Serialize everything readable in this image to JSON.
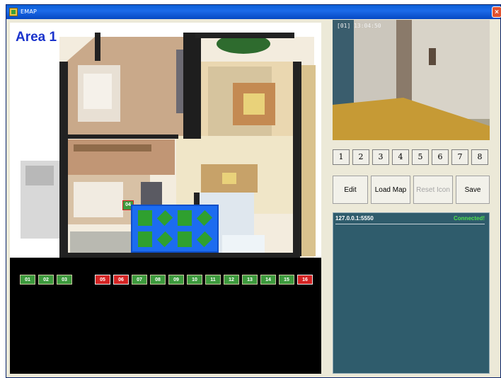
{
  "window": {
    "title": "EMAP",
    "close_glyph": "×"
  },
  "map": {
    "area_title": "Area 1",
    "placed_camera_label": "04",
    "icon_palette": [
      "camera-right-icon",
      "camera-diag-icon",
      "camera-up-icon",
      "camera-diag2-icon",
      "camera-left-icon",
      "camera-diag3-icon",
      "camera-down-icon",
      "camera-diag4-icon"
    ]
  },
  "cameras": [
    {
      "label": "01",
      "state": "ok"
    },
    {
      "label": "02",
      "state": "ok"
    },
    {
      "label": "03",
      "state": "ok"
    },
    {
      "label": "05",
      "state": "alarm"
    },
    {
      "label": "06",
      "state": "alarm"
    },
    {
      "label": "07",
      "state": "ok"
    },
    {
      "label": "08",
      "state": "ok"
    },
    {
      "label": "09",
      "state": "ok"
    },
    {
      "label": "10",
      "state": "ok"
    },
    {
      "label": "11",
      "state": "ok"
    },
    {
      "label": "12",
      "state": "ok"
    },
    {
      "label": "13",
      "state": "ok"
    },
    {
      "label": "14",
      "state": "ok"
    },
    {
      "label": "15",
      "state": "ok"
    },
    {
      "label": "16",
      "state": "alarm"
    }
  ],
  "video": {
    "timestamp": "[01] 13:04:50"
  },
  "channels": [
    "1",
    "2",
    "3",
    "4",
    "5",
    "6",
    "7",
    "8"
  ],
  "actions": {
    "edit": "Edit",
    "load_map": "Load Map",
    "reset_icon": "Reset Icon",
    "save": "Save"
  },
  "log": {
    "host": "127.0.0.1:5550",
    "status": "Connected!"
  },
  "colors": {
    "accent": "#1a33cc",
    "ok": "#3d9a3d",
    "alarm": "#d42424",
    "log_bg": "#2f5c6c",
    "connected": "#4ee24e"
  }
}
